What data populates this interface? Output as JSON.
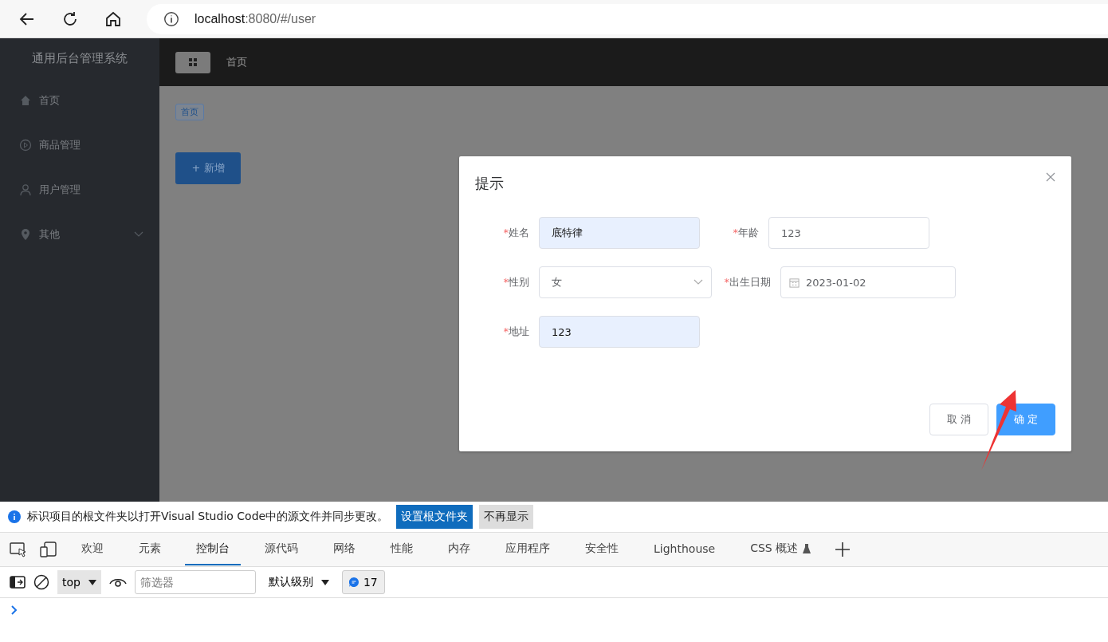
{
  "browser": {
    "url_host": "localhost",
    "url_rest": ":8080/#/user"
  },
  "sidebar": {
    "title": "通用后台管理系统",
    "items": [
      {
        "label": "首页",
        "kind": "home",
        "has_children": false
      },
      {
        "label": "商品管理",
        "kind": "play",
        "has_children": false
      },
      {
        "label": "用户管理",
        "kind": "user",
        "has_children": false
      },
      {
        "label": "其他",
        "kind": "location",
        "has_children": true
      }
    ]
  },
  "header": {
    "breadcrumb": "首页"
  },
  "main": {
    "tag": "首页",
    "add_button": "+ 新增"
  },
  "dialog": {
    "title": "提示",
    "rows": [
      [
        {
          "label": "姓名",
          "required_mark": "*",
          "kind": "input",
          "value": "底特律",
          "autofilled": true
        },
        {
          "label": "年龄",
          "required_mark": "*",
          "kind": "input",
          "value": "123",
          "autofilled": false
        }
      ],
      [
        {
          "label": "性别",
          "required_mark": "*",
          "kind": "select",
          "value": "女",
          "autofilled": false
        },
        {
          "label": "出生日期",
          "required_mark": "*",
          "kind": "date",
          "value": "2023-01-02",
          "autofilled": false
        }
      ],
      [
        {
          "label": "地址",
          "required_mark": "*",
          "kind": "input",
          "value": "123",
          "autofilled": true
        }
      ]
    ],
    "buttons": [
      {
        "label": "取 消",
        "primary": false
      },
      {
        "label": "确 定",
        "primary": true
      }
    ]
  },
  "devtools": {
    "info": "标识项目的根文件夹以打开Visual Studio Code中的源文件并同步更改。",
    "info_buttons": [
      {
        "label": "设置根文件夹",
        "primary": true
      },
      {
        "label": "不再显示",
        "primary": false
      }
    ],
    "tabs": [
      {
        "label": "欢迎",
        "selected": false
      },
      {
        "label": "元素",
        "selected": false
      },
      {
        "label": "控制台",
        "selected": true
      },
      {
        "label": "源代码",
        "selected": false
      },
      {
        "label": "网络",
        "selected": false
      },
      {
        "label": "性能",
        "selected": false
      },
      {
        "label": "内存",
        "selected": false
      },
      {
        "label": "应用程序",
        "selected": false
      },
      {
        "label": "安全性",
        "selected": false
      },
      {
        "label": "Lighthouse",
        "selected": false
      },
      {
        "label": "CSS 概述",
        "selected": false
      }
    ],
    "context": "top",
    "filter_placeholder": "筛选器",
    "level": "默认级别",
    "issues": "17"
  }
}
